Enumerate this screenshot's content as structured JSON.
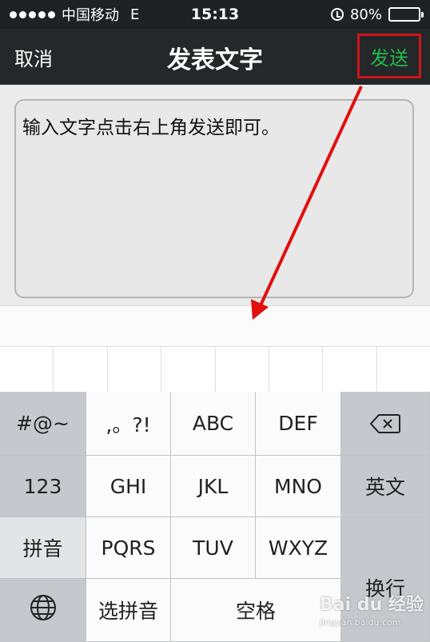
{
  "status_bar": {
    "carrier": "中国移动",
    "network": "E",
    "time": "15:13",
    "battery": "80%",
    "battery_level": 0.8
  },
  "nav": {
    "cancel_label": "取消",
    "title": "发表文字",
    "send_label": "发送"
  },
  "compose": {
    "text": "输入文字点击右上角发送即可。"
  },
  "keyboard": {
    "symbols": "#@~",
    "numbers": "123",
    "pinyin": "拼音",
    "punct": ",。?!",
    "abc": "ABC",
    "def": "DEF",
    "ghi": "GHI",
    "jkl": "JKL",
    "mno": "MNO",
    "english": "英文",
    "pqrs": "PQRS",
    "tuv": "TUV",
    "wxyz": "WXYZ",
    "newline": "换行",
    "choose_pinyin": "选拼音",
    "space": "空格"
  },
  "watermark": {
    "brand": "Bai du 经验",
    "url": "jingyan.baidu.com"
  },
  "colors": {
    "send_green": "#22b84a",
    "highlight_red": "#d01418",
    "navbar": "#24282a"
  }
}
